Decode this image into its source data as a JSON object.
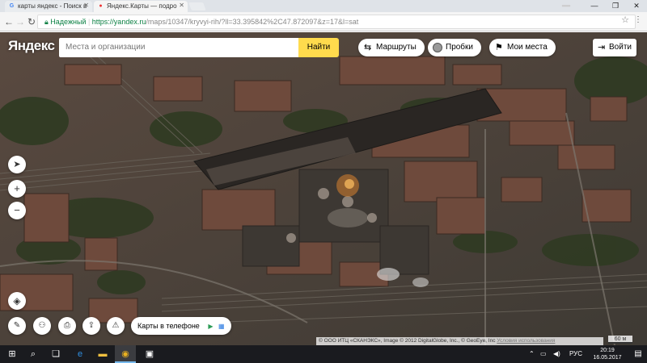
{
  "browser": {
    "tabs": [
      {
        "label": "карты яндекс - Поиск в",
        "favicon": "G"
      },
      {
        "label": "Яндекс.Карты — подро",
        "favicon": "●"
      }
    ],
    "address": {
      "secure_label": "Надежный",
      "url_host": "https://yandex.ru",
      "url_path": "/maps/10347/kryvyi-rih/?ll=33.395842%2C47.872097&z=17&l=sat"
    },
    "window_controls": {
      "minimize": "—",
      "maximize": "❐",
      "close": "✕"
    }
  },
  "header": {
    "logo": "Яндекс",
    "search_placeholder": "Места и организации",
    "search_button": "Найти",
    "routes_label": "Маршруты",
    "traffic_label": "Пробки",
    "my_places_label": "Мои места",
    "login_label": "Войти"
  },
  "controls": {
    "locate": "➤",
    "zoom_in": "+",
    "zoom_out": "−",
    "layers": "◈",
    "ruler": "✎",
    "panorama": "⚇",
    "print": "⎙",
    "share": "⇪",
    "report": "⚠"
  },
  "apps": {
    "label": "Карты в телефоне"
  },
  "footer": {
    "copyright": "© ООО ИТЦ «СКАНЭКС», Image © 2012 DigitalGlobe, Inc., © GeoEye, Inc ",
    "terms": "Условия использования",
    "scale": "60 м"
  },
  "taskbar": {
    "start": "⊞",
    "search": "⌕",
    "taskview": "❏",
    "lang": "РУС",
    "time": "20:19",
    "date": "16.05.2017"
  }
}
